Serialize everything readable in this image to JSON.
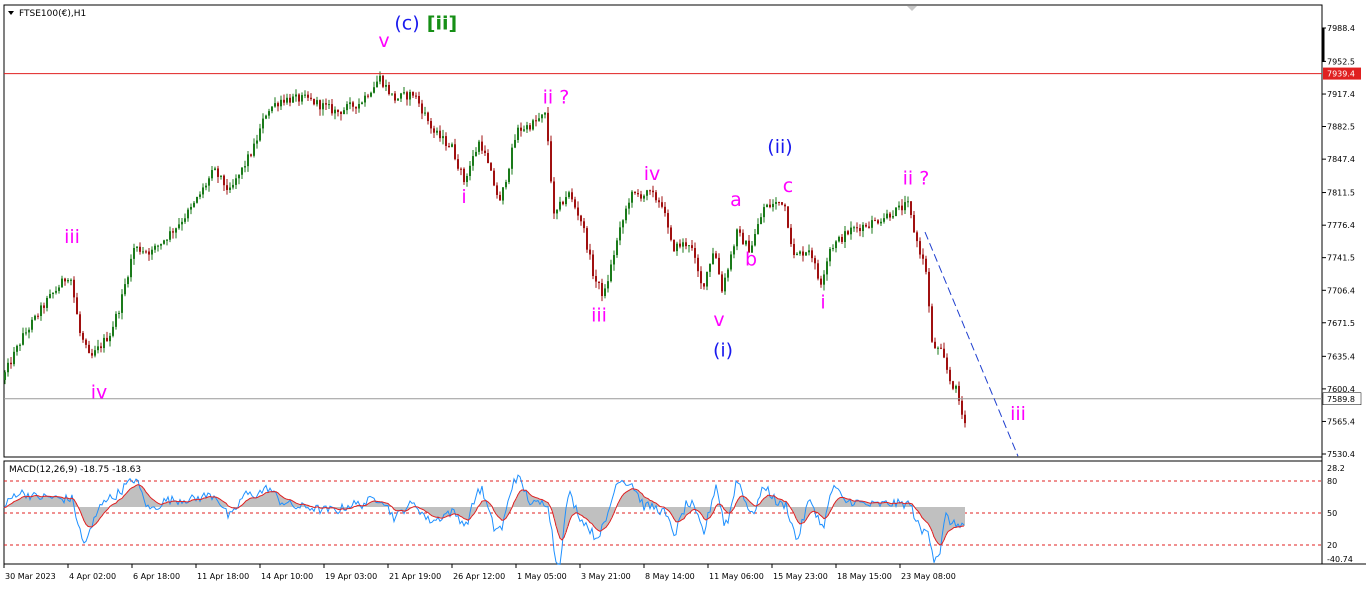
{
  "chart_data": [
    {
      "type": "candlestick",
      "symbol_label": "FTSE100(€),H1",
      "y_ticks": [
        "7988.4",
        "7952.5",
        "7917.4",
        "7882.5",
        "7847.4",
        "7811.5",
        "7776.4",
        "7741.5",
        "7706.4",
        "7671.5",
        "7635.4",
        "7600.4",
        "7565.4",
        "7530.4"
      ],
      "ylim": [
        7524,
        7999
      ],
      "x_tick_labels": [
        "30 Mar 2023",
        "4 Apr 02:00",
        "6 Apr 18:00",
        "11 Apr 18:00",
        "14 Apr 10:00",
        "19 Apr 03:00",
        "21 Apr 19:00",
        "26 Apr 12:00",
        "1 May 05:00",
        "3 May 21:00",
        "8 May 14:00",
        "11 May 06:00",
        "15 May 23:00",
        "18 May 15:00",
        "23 May 08:00"
      ],
      "horizontal_lines": [
        {
          "price": 7939.4,
          "label": "7939.4",
          "color": "#e02020"
        },
        {
          "price": 7589.8,
          "label": "7589.8",
          "color": "#999999"
        }
      ],
      "price_path": [
        {
          "i": 0,
          "p": 7610
        },
        {
          "i": 20,
          "p": 7655
        },
        {
          "i": 45,
          "p": 7695
        },
        {
          "i": 68,
          "p": 7725
        },
        {
          "i": 78,
          "p": 7660
        },
        {
          "i": 88,
          "p": 7632
        },
        {
          "i": 108,
          "p": 7660
        },
        {
          "i": 118,
          "p": 7690
        },
        {
          "i": 132,
          "p": 7752
        },
        {
          "i": 150,
          "p": 7748
        },
        {
          "i": 170,
          "p": 7770
        },
        {
          "i": 190,
          "p": 7795
        },
        {
          "i": 212,
          "p": 7835
        },
        {
          "i": 228,
          "p": 7812
        },
        {
          "i": 252,
          "p": 7860
        },
        {
          "i": 265,
          "p": 7900
        },
        {
          "i": 280,
          "p": 7912
        },
        {
          "i": 305,
          "p": 7912
        },
        {
          "i": 335,
          "p": 7898
        },
        {
          "i": 358,
          "p": 7908
        },
        {
          "i": 378,
          "p": 7935
        },
        {
          "i": 392,
          "p": 7912
        },
        {
          "i": 412,
          "p": 7918
        },
        {
          "i": 432,
          "p": 7876
        },
        {
          "i": 450,
          "p": 7860
        },
        {
          "i": 462,
          "p": 7824
        },
        {
          "i": 478,
          "p": 7868
        },
        {
          "i": 498,
          "p": 7800
        },
        {
          "i": 515,
          "p": 7878
        },
        {
          "i": 530,
          "p": 7885
        },
        {
          "i": 544,
          "p": 7895
        },
        {
          "i": 552,
          "p": 7785
        },
        {
          "i": 566,
          "p": 7812
        },
        {
          "i": 580,
          "p": 7780
        },
        {
          "i": 592,
          "p": 7720
        },
        {
          "i": 602,
          "p": 7700
        },
        {
          "i": 614,
          "p": 7755
        },
        {
          "i": 628,
          "p": 7808
        },
        {
          "i": 648,
          "p": 7810
        },
        {
          "i": 660,
          "p": 7800
        },
        {
          "i": 670,
          "p": 7752
        },
        {
          "i": 688,
          "p": 7758
        },
        {
          "i": 700,
          "p": 7708
        },
        {
          "i": 712,
          "p": 7752
        },
        {
          "i": 720,
          "p": 7708
        },
        {
          "i": 735,
          "p": 7768
        },
        {
          "i": 748,
          "p": 7750
        },
        {
          "i": 762,
          "p": 7795
        },
        {
          "i": 782,
          "p": 7803
        },
        {
          "i": 792,
          "p": 7742
        },
        {
          "i": 808,
          "p": 7752
        },
        {
          "i": 818,
          "p": 7712
        },
        {
          "i": 828,
          "p": 7752
        },
        {
          "i": 850,
          "p": 7772
        },
        {
          "i": 872,
          "p": 7780
        },
        {
          "i": 890,
          "p": 7790
        },
        {
          "i": 906,
          "p": 7798
        },
        {
          "i": 914,
          "p": 7762
        },
        {
          "i": 924,
          "p": 7728
        },
        {
          "i": 930,
          "p": 7648
        },
        {
          "i": 940,
          "p": 7638
        },
        {
          "i": 948,
          "p": 7610
        },
        {
          "i": 955,
          "p": 7597
        },
        {
          "i": 961,
          "p": 7568
        }
      ],
      "trendline": {
        "from": {
          "i": 921,
          "p": 7769
        },
        "to": {
          "i": 1014,
          "p": 7528
        },
        "color": "#1f3fcf",
        "style": "dashed"
      },
      "wave_labels": [
        {
          "text": "v",
          "color": "#ff00ff",
          "i": 380,
          "p": 7968
        },
        {
          "text": "(c)",
          "color": "#1a1aee",
          "i": 403,
          "p": 7987
        },
        {
          "text": "[ii]",
          "color": "#168f16",
          "i": 438,
          "p": 7987
        },
        {
          "text": "iii",
          "color": "#ff00ff",
          "i": 68,
          "p": 7757
        },
        {
          "text": "iv",
          "color": "#ff00ff",
          "i": 95,
          "p": 7590
        },
        {
          "text": "ii ?",
          "color": "#ff00ff",
          "i": 552,
          "p": 7907
        },
        {
          "text": "i",
          "color": "#ff00ff",
          "i": 460,
          "p": 7800
        },
        {
          "text": "iii",
          "color": "#ff00ff",
          "i": 595,
          "p": 7673
        },
        {
          "text": "iv",
          "color": "#ff00ff",
          "i": 648,
          "p": 7825
        },
        {
          "text": "(ii)",
          "color": "#1a1aee",
          "i": 776,
          "p": 7854
        },
        {
          "text": "c",
          "color": "#ff00ff",
          "i": 784,
          "p": 7812
        },
        {
          "text": "a",
          "color": "#ff00ff",
          "i": 732,
          "p": 7797
        },
        {
          "text": "b",
          "color": "#ff00ff",
          "i": 747,
          "p": 7733
        },
        {
          "text": "v",
          "color": "#ff00ff",
          "i": 715,
          "p": 7668
        },
        {
          "text": "(i)",
          "color": "#1a1aee",
          "i": 719,
          "p": 7635
        },
        {
          "text": "i",
          "color": "#ff00ff",
          "i": 819,
          "p": 7687
        },
        {
          "text": "ii ?",
          "color": "#ff00ff",
          "i": 912,
          "p": 7820
        },
        {
          "text": "iii",
          "color": "#ff00ff",
          "i": 1014,
          "p": 7567
        }
      ]
    },
    {
      "type": "macd",
      "label": "MACD(12,26,9) -18.75 -18.63",
      "y_ticks": [
        "28.2",
        "80",
        "50",
        "20",
        "-40.74"
      ],
      "reference_lines": [
        "80",
        "50",
        "20"
      ],
      "colors": {
        "histogram": "#c0c0c0",
        "signal": "#e02020",
        "main": "#1e90ff"
      }
    }
  ]
}
